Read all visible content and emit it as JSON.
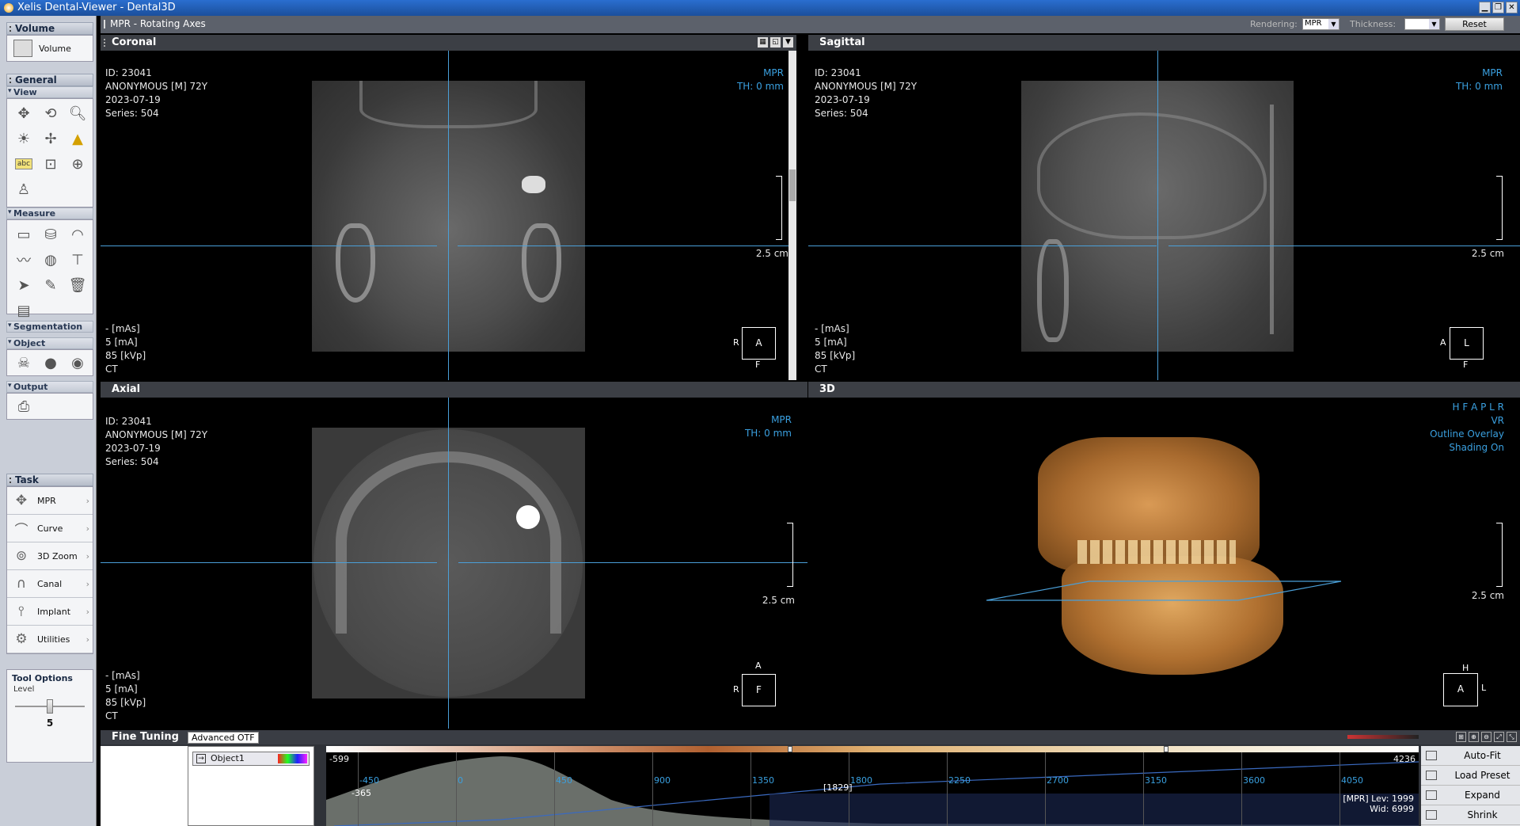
{
  "window": {
    "title": "Xelis Dental-Viewer - Dental3D"
  },
  "left_panel": {
    "volume_header": "Volume",
    "volume_button": "Volume",
    "general_header": "General",
    "view_label": "View",
    "measure_label": "Measure",
    "segmentation_label": "Segmentation",
    "object_label": "Object",
    "output_label": "Output",
    "task_header": "Task",
    "tasks": [
      "MPR",
      "Curve",
      "3D Zoom",
      "Canal",
      "Implant",
      "Utilities"
    ],
    "tool_options_label": "Tool Options",
    "level_label": "Level",
    "level_value": "5",
    "level_fraction": 0.5
  },
  "main_header": {
    "title": "MPR - Rotating Axes",
    "rendering_label": "Rendering:",
    "rendering_value": "MPR",
    "thickness_label": "Thickness:",
    "thickness_value": "",
    "reset_label": "Reset"
  },
  "patient": {
    "id": "ID: 23041",
    "name": "ANONYMOUS [M] 72Y",
    "date": "2023-07-19",
    "series": "Series: 504",
    "mas": "- [mAs]",
    "ma": "5 [mA]",
    "kvp": "85 [kVp]",
    "modality": "CT"
  },
  "viewports": {
    "coronal": {
      "title": "Coronal",
      "mode": "MPR",
      "th": "TH: 0 mm",
      "scale": "2.5 cm",
      "orient_box": "A",
      "orient_left": "R",
      "orient_bottom": "F"
    },
    "sagittal": {
      "title": "Sagittal",
      "mode": "MPR",
      "th": "TH: 0 mm",
      "scale": "2.5 cm",
      "orient_box": "L",
      "orient_left": "A",
      "orient_bottom": "F"
    },
    "axial": {
      "title": "Axial",
      "mode": "MPR",
      "th": "TH: 0 mm",
      "scale": "2.5 cm",
      "orient_box": "F",
      "orient_left": "R",
      "orient_top": "A"
    },
    "three_d": {
      "title": "3D",
      "orient_codes": "H F A P L R",
      "mode": "VR",
      "overlay": "Outline Overlay",
      "shading": "Shading On",
      "scale": "2.5 cm",
      "orient_top": "H",
      "orient_box": "A",
      "orient_side": "L"
    }
  },
  "fine_tuning": {
    "title": "Fine Tuning",
    "advanced_label": "Advanced OTF",
    "object_name": "Object1",
    "hist_min": "-599",
    "hist_max": "4236",
    "ticks": [
      "-450",
      "0",
      "450",
      "900",
      "1350",
      "1800",
      "2250",
      "2700",
      "3150",
      "3600",
      "4050"
    ],
    "cursor_low": "-365",
    "cursor_val": "[1829]",
    "lev_label": "[MPR] Lev:",
    "lev_value": "1999",
    "wid_label": "Wid:",
    "wid_value": "6999",
    "buttons": [
      "Auto-Fit",
      "Load Preset",
      "Expand",
      "Shrink"
    ]
  }
}
